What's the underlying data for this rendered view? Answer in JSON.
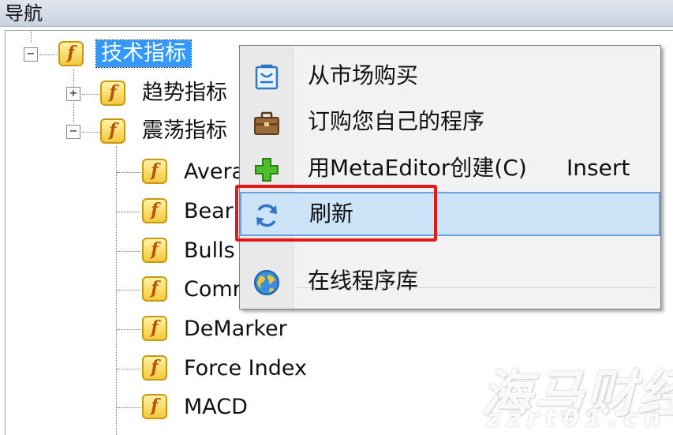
{
  "header": {
    "title": "导航"
  },
  "tree": {
    "root": {
      "label": "技术指标",
      "expander": "−"
    },
    "groups": [
      {
        "label": "趋势指标",
        "expander": "+"
      },
      {
        "label": "震荡指标",
        "expander": "−"
      }
    ],
    "items": [
      "Avera",
      "Bear",
      "Bulls",
      "Comr",
      "DeMarker",
      "Force Index",
      "MACD"
    ],
    "icon_glyph": "f"
  },
  "context_menu": {
    "items": [
      {
        "label": "从市场购买",
        "shortcut": "",
        "icon": "market-icon"
      },
      {
        "label": "订购您自己的程序",
        "shortcut": "",
        "icon": "briefcase-icon"
      },
      {
        "label": "用MetaEditor创建(C)",
        "shortcut": "Insert",
        "icon": "plus-icon"
      },
      {
        "label": "刷新",
        "shortcut": "",
        "icon": "refresh-icon"
      },
      {
        "label": "在线程序库",
        "shortcut": "",
        "icon": "globe-icon"
      }
    ]
  },
  "watermark": {
    "text": "海马财经",
    "url": "zzrt01.cn"
  },
  "colors": {
    "selection": "#3399ff",
    "highlight_box": "#e0191a",
    "menu_hover": "#cde3f7"
  }
}
